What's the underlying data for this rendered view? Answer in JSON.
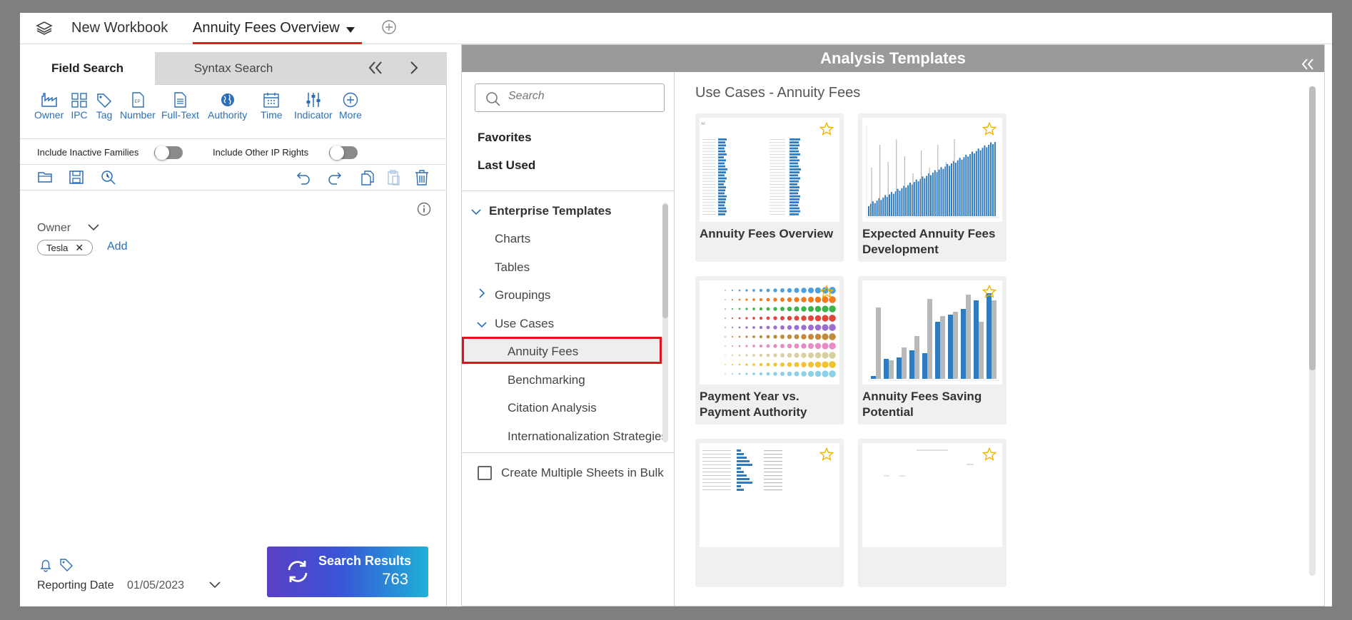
{
  "topbar": {
    "workbook_icon": "layers-icon",
    "tab_new": "New Workbook",
    "tab_active": "Annuity Fees Overview",
    "accent_color": "#e02020"
  },
  "left_panel": {
    "tabs": [
      "Field Search",
      "Syntax Search"
    ],
    "field_buttons": [
      {
        "label": "Owner",
        "icon": "factory-icon"
      },
      {
        "label": "IPC",
        "icon": "grid-icon"
      },
      {
        "label": "Tag",
        "icon": "tag-icon"
      },
      {
        "label": "Number",
        "icon": "document-number-icon"
      },
      {
        "label": "Full-Text",
        "icon": "document-text-icon"
      },
      {
        "label": "Authority",
        "icon": "globe-icon"
      },
      {
        "label": "Time",
        "icon": "calendar-icon"
      },
      {
        "label": "Indicator",
        "icon": "sliders-icon"
      },
      {
        "label": "More",
        "icon": "plus-circle-icon"
      }
    ],
    "toggles": {
      "inactive_families": "Include Inactive Families",
      "other_ip_rights": "Include Other IP Rights"
    },
    "owner_field": {
      "label": "Owner",
      "chip": "Tesla",
      "add": "Add"
    },
    "footer": {
      "reporting_label": "Reporting Date",
      "reporting_date": "01/05/2023",
      "search_button": "Search Results",
      "result_count": "763"
    }
  },
  "right_panel": {
    "header": "Analysis Templates",
    "search_placeholder": "Search",
    "favorites": "Favorites",
    "last_used": "Last Used",
    "tree": {
      "enterprise": "Enterprise Templates",
      "charts": "Charts",
      "tables": "Tables",
      "groupings": "Groupings",
      "use_cases": "Use Cases",
      "annuity_fees": "Annuity Fees",
      "benchmarking": "Benchmarking",
      "citation": "Citation Analysis",
      "internationalization": "Internationalization Strategies"
    },
    "bulk_label": "Create Multiple Sheets in Bulk",
    "section_title": "Use Cases - Annuity Fees",
    "cards": [
      {
        "title": "Annuity Fees Overview"
      },
      {
        "title": "Expected Annuity Fees Development"
      },
      {
        "title": "Payment Year vs. Payment Authority"
      },
      {
        "title": "Annuity Fees Saving Potential"
      },
      {
        "title": ""
      },
      {
        "title": ""
      }
    ],
    "colors": {
      "bar_blue": "#2f7bbf",
      "bar_gray": "#b8b8b8",
      "star": "#f0b400",
      "selection_border": "#e0141e"
    }
  }
}
